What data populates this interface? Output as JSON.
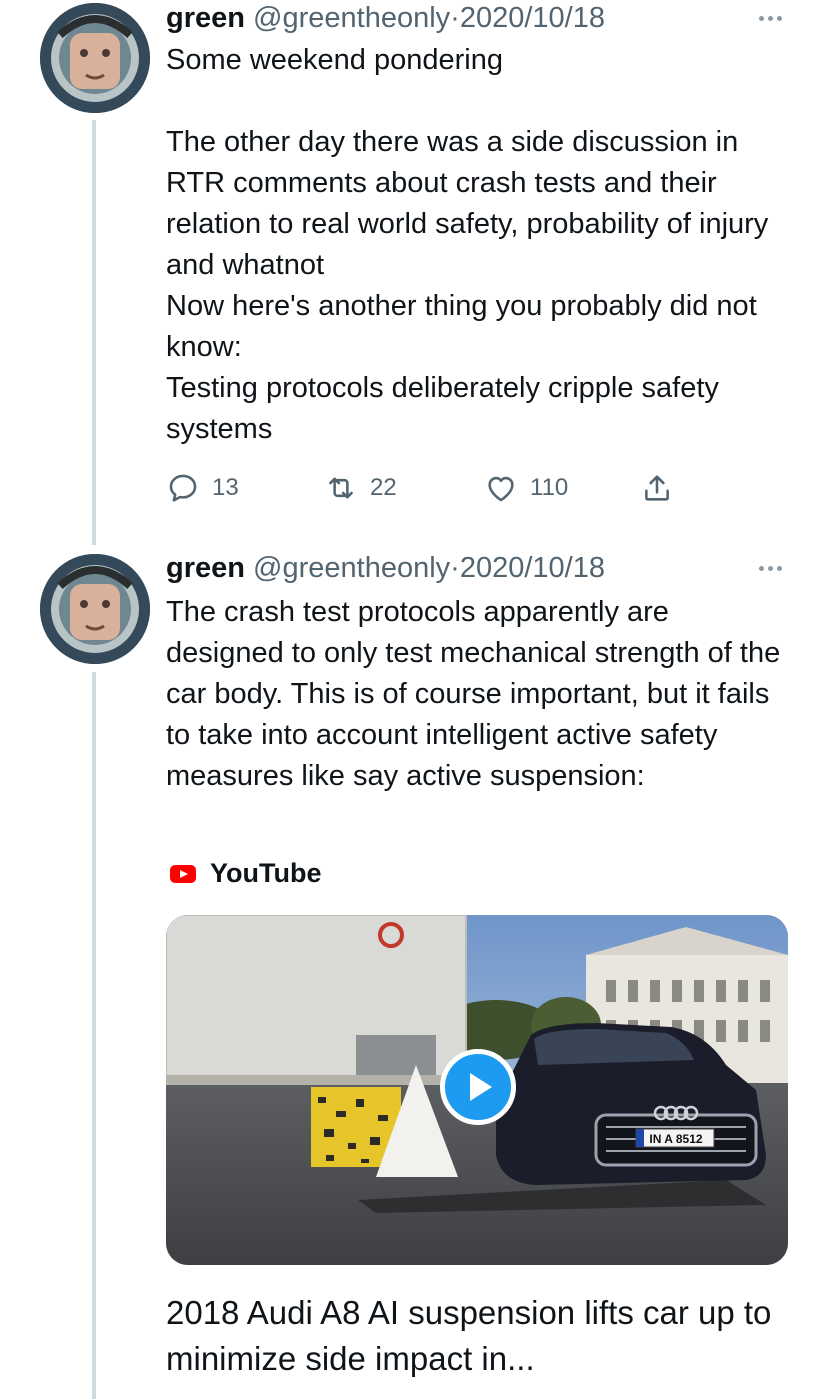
{
  "tweets": [
    {
      "name": "green",
      "handle": "@greentheonly",
      "separator": "·",
      "date": "2020/10/18",
      "text": "Some weekend pondering\n\nThe other day there was a side discussion in RTR comments about crash tests and their relation to real world safety, probability of injury and whatnot\nNow here's another thing you probably did not know:\nTesting protocols deliberately cripple safety systems",
      "replies": "13",
      "retweets": "22",
      "likes": "110"
    },
    {
      "name": "green",
      "handle": "@greentheonly",
      "separator": "·",
      "date": "2020/10/18",
      "text": "The crash test protocols apparently are designed to only test mechanical strength of the car body. This is of course important, but it fails to take into account intelligent active safety measures like say active suspension:",
      "card": {
        "source": "YouTube",
        "plate": "IN A 8512",
        "title": "2018 Audi A8 AI suspension lifts car up to minimize side impact in..."
      }
    }
  ],
  "icons": [
    "more-icon",
    "reply-icon",
    "retweet-icon",
    "like-icon",
    "share-icon",
    "youtube-icon",
    "play-icon"
  ],
  "colors": {
    "text": "#0f1419",
    "muted": "#536471",
    "accent": "#1d9bf0",
    "thread_line": "#cfd9de",
    "youtube": "#ff0000"
  }
}
